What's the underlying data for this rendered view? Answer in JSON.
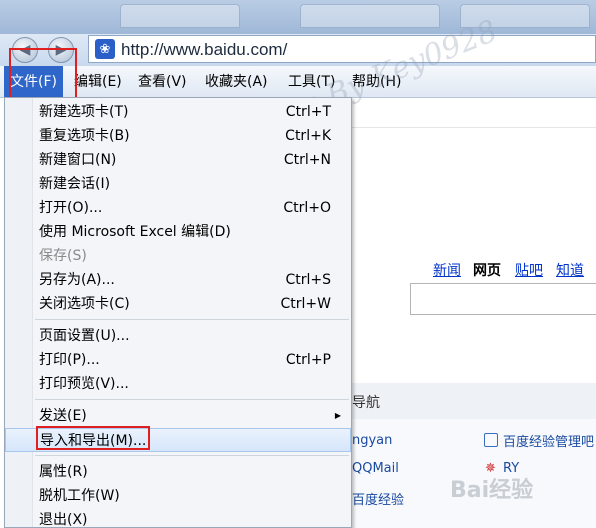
{
  "browser": {
    "address": "http://www.baidu.com/"
  },
  "menubar": [
    {
      "label": "文件(F)"
    },
    {
      "label": "编辑(E)"
    },
    {
      "label": "查看(V)"
    },
    {
      "label": "收藏夹(A)"
    },
    {
      "label": "工具(T)"
    },
    {
      "label": "帮助(H)"
    }
  ],
  "file_menu": {
    "items": [
      {
        "label": "新建选项卡(T)",
        "shortcut": "Ctrl+T"
      },
      {
        "label": "重复选项卡(B)",
        "shortcut": "Ctrl+K"
      },
      {
        "label": "新建窗口(N)",
        "shortcut": "Ctrl+N"
      },
      {
        "label": "新建会话(I)",
        "shortcut": ""
      },
      {
        "label": "打开(O)...",
        "shortcut": "Ctrl+O"
      },
      {
        "label": "使用 Microsoft Excel 编辑(D)",
        "shortcut": ""
      },
      {
        "label": "保存(S)",
        "shortcut": "",
        "disabled": true
      },
      {
        "label": "另存为(A)...",
        "shortcut": "Ctrl+S"
      },
      {
        "label": "关闭选项卡(C)",
        "shortcut": "Ctrl+W"
      },
      {
        "label": "页面设置(U)...",
        "shortcut": ""
      },
      {
        "label": "打印(P)...",
        "shortcut": "Ctrl+P"
      },
      {
        "label": "打印预览(V)...",
        "shortcut": ""
      },
      {
        "label": "发送(E)",
        "shortcut": "",
        "submenu": true
      },
      {
        "label": "导入和导出(M)...",
        "shortcut": "",
        "highlighted": true
      },
      {
        "label": "属性(R)",
        "shortcut": ""
      },
      {
        "label": "脱机工作(W)",
        "shortcut": ""
      },
      {
        "label": "退出(X)",
        "shortcut": ""
      }
    ]
  },
  "page": {
    "links": [
      "新闻",
      "网页",
      "贴吧",
      "知道"
    ],
    "nav_title": "导航",
    "nav_items": [
      "ngyan",
      "百度经验管理吧",
      "QQMail",
      "RY",
      "百度经验"
    ]
  },
  "watermarks": {
    "diagonal": "Tips By Key0928",
    "baidu": "Bai经验"
  },
  "colors": {
    "highlight_box": "#e02020",
    "menu_active": "#2f66c9",
    "link": "#0033cc"
  }
}
